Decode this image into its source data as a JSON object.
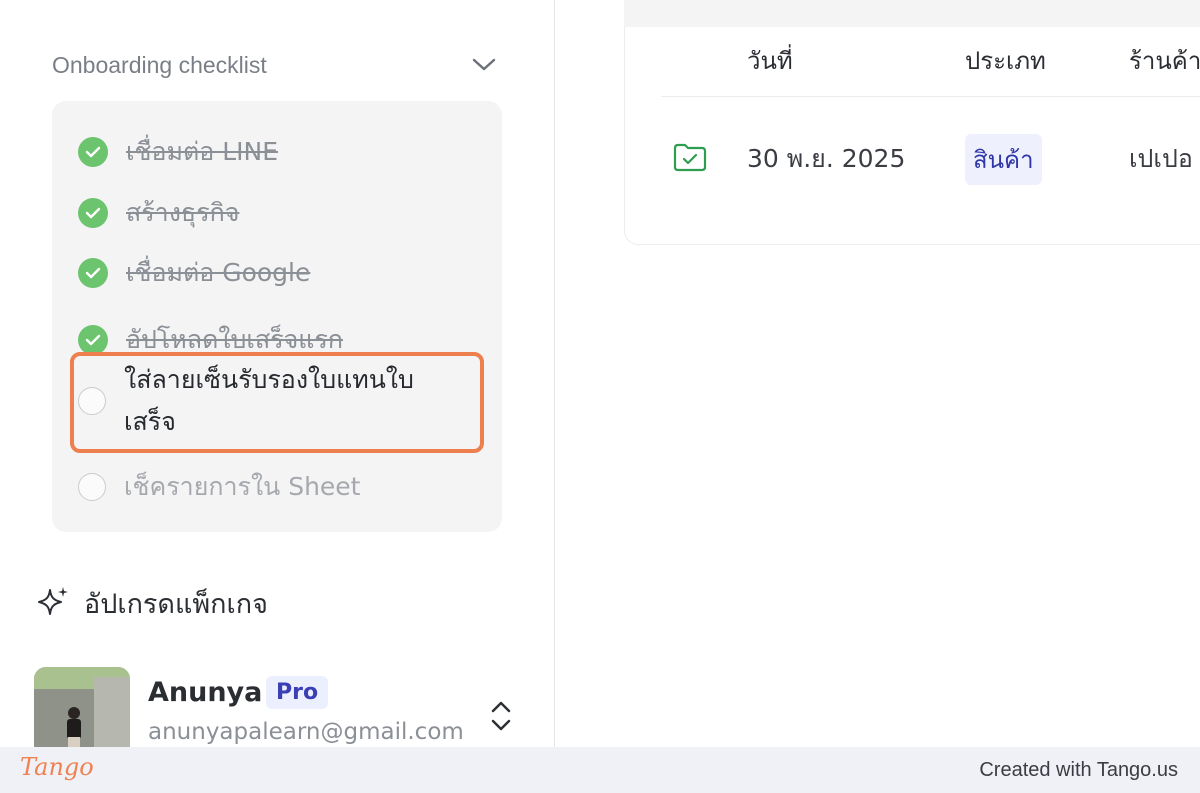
{
  "sidebar": {
    "checklist": {
      "title": "Onboarding checklist",
      "items": [
        {
          "label": "เชื่อมต่อ LINE",
          "status": "done"
        },
        {
          "label": "สร้างธุรกิจ",
          "status": "done"
        },
        {
          "label": "เชื่อมต่อ Google",
          "status": "done"
        },
        {
          "label": "อัปโหลดใบเสร็จแรก",
          "status": "done"
        },
        {
          "label": "ใส่ลายเซ็นรับรองใบแทนใบเสร็จ",
          "status": "active",
          "line1": "ใส่ลายเซ็นรับรองใบแทนใบ",
          "line2": "เสร็จ"
        },
        {
          "label": "เช็ครายการใน Sheet",
          "status": "pending"
        }
      ]
    },
    "upgrade": {
      "label": "อัปเกรดแพ็กเกจ",
      "icon": "sparkle-icon"
    },
    "user": {
      "name": "Anunya",
      "plan_badge": "Pro",
      "email": "anunyapalearn@gmail.com"
    }
  },
  "main": {
    "table": {
      "columns": [
        "วันที่",
        "ประเภท",
        "ร้านค้า"
      ],
      "rows": [
        {
          "date": "30 พ.ย. 2025",
          "category": "สินค้า",
          "store": "เปเปอ",
          "icon": "folder-check-icon"
        }
      ]
    }
  },
  "footer": {
    "logo": "Tango",
    "created_with": "Created with Tango.us"
  },
  "colors": {
    "accent_highlight": "#ee7f4e",
    "check_green": "#6cc46e",
    "badge_blue": "#3b3fb6",
    "folder_green": "#2e9d4f"
  }
}
